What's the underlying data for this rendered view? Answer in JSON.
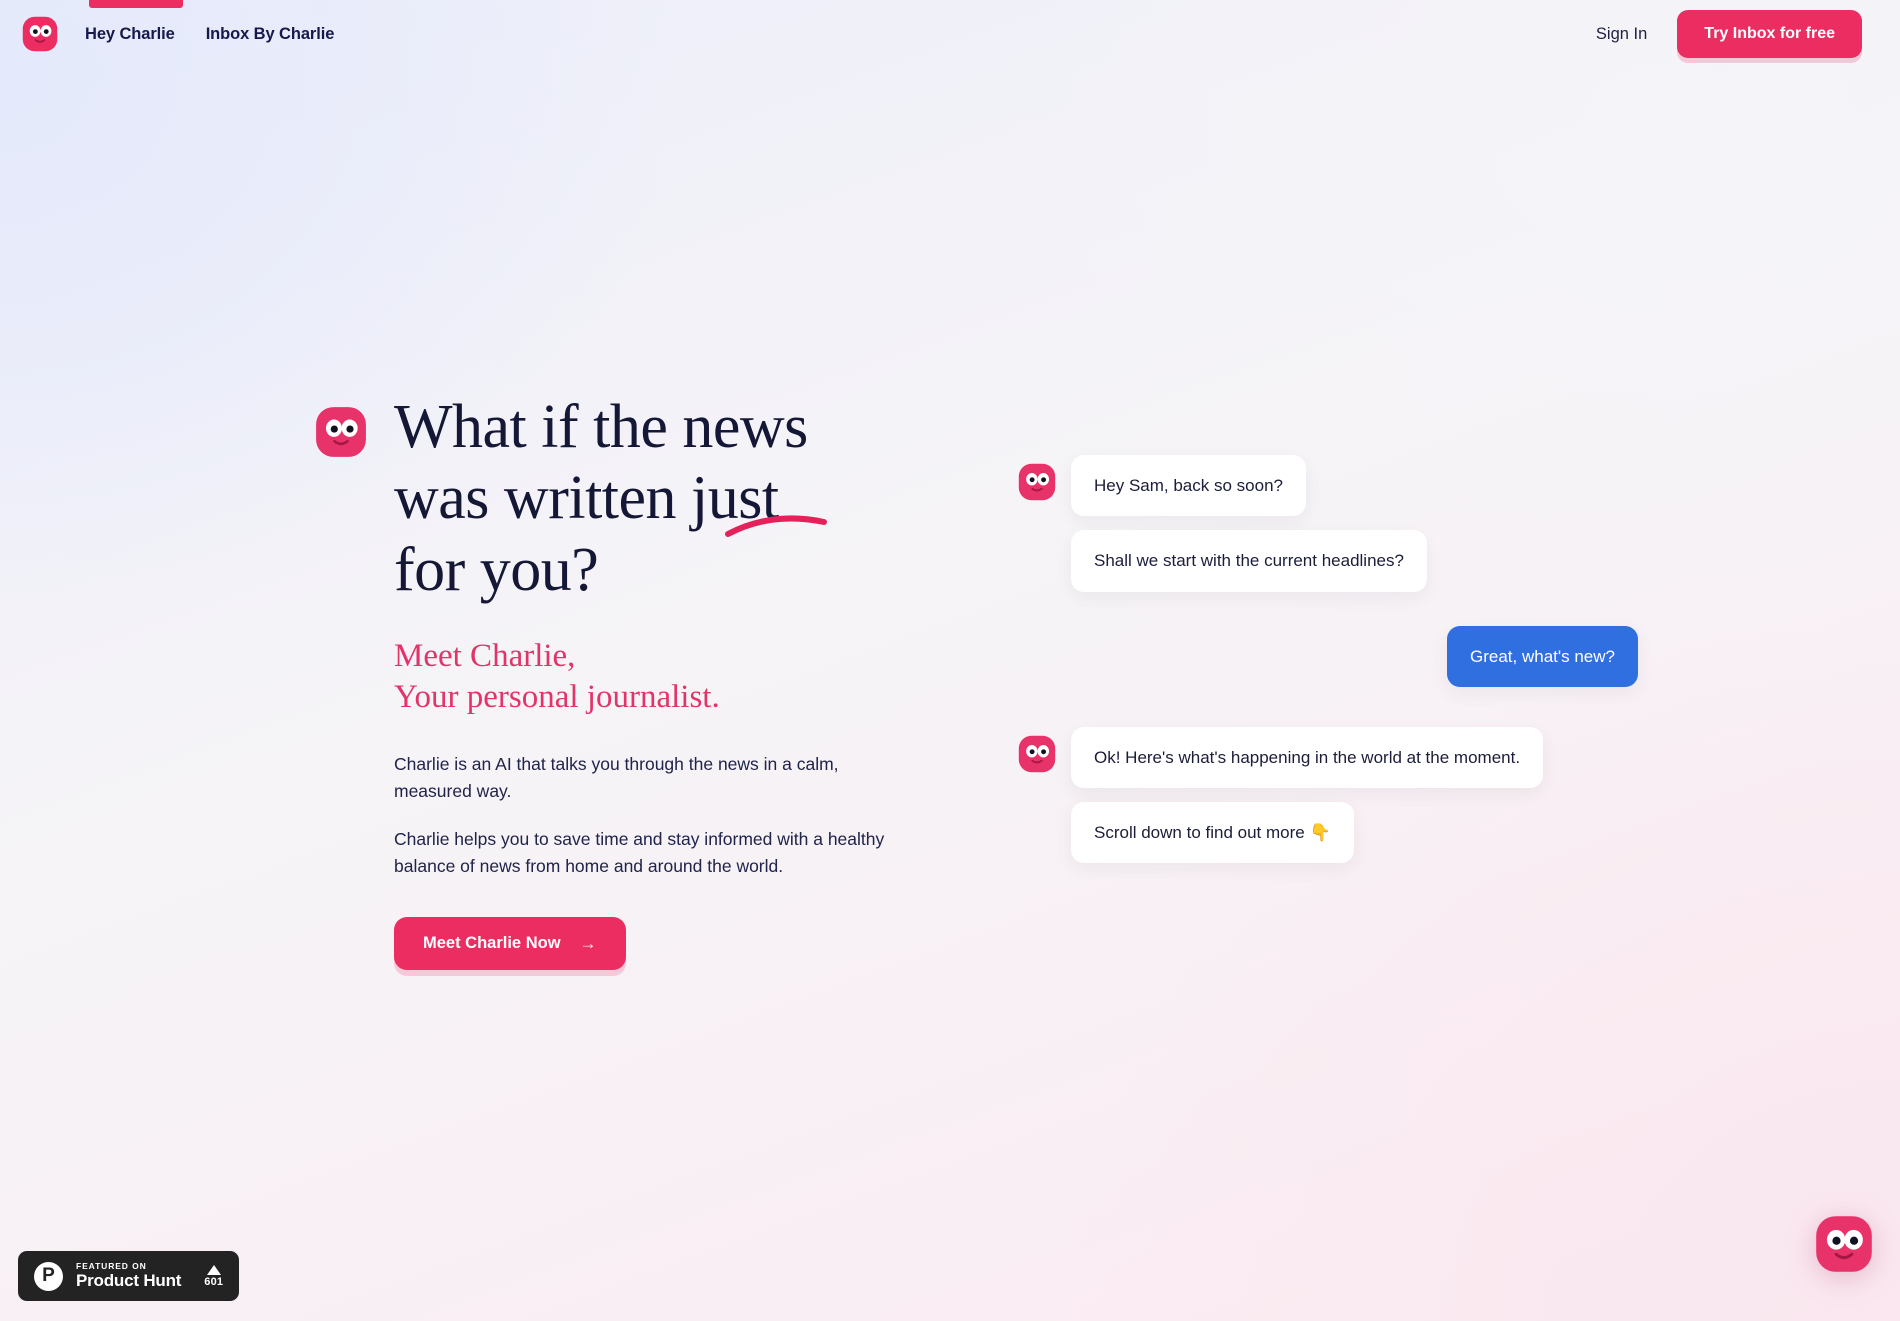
{
  "brand": {
    "logo_icon": "charlie-face-icon",
    "accent_pink": "#ec2d62",
    "accent_blue": "#2f6fe0",
    "ink": "#141735"
  },
  "header": {
    "nav": [
      {
        "label": "Hey Charlie",
        "active": true
      },
      {
        "label": "Inbox By Charlie",
        "active": false
      }
    ],
    "signin_label": "Sign In",
    "cta_label": "Try Inbox for free"
  },
  "hero": {
    "title_line1": "What if the news",
    "title_line2": "was written just",
    "title_line3": "for you?",
    "subtitle_line1": "Meet Charlie,",
    "subtitle_line2": "Your personal journalist.",
    "paragraph1": "Charlie is an AI that talks you through the news in a calm, measured way.",
    "paragraph2": "Charlie helps you to save time and stay informed with a healthy balance of news from home and around the world.",
    "cta_label": "Meet Charlie Now",
    "cta_arrow": "→"
  },
  "chat": {
    "messages": [
      {
        "from": "charlie",
        "text": "Hey Sam, back so soon?",
        "show_avatar": true
      },
      {
        "from": "charlie",
        "text": "Shall we start with the current headlines?",
        "show_avatar": false
      },
      {
        "from": "user",
        "text": "Great, what's new?",
        "show_avatar": false
      },
      {
        "from": "charlie",
        "text": "Ok! Here's what's happening in the world at the moment.",
        "show_avatar": true
      },
      {
        "from": "charlie",
        "text": "Scroll down to find out more 👇",
        "show_avatar": false
      }
    ]
  },
  "product_hunt": {
    "featured_label": "FEATURED ON",
    "name": "Product Hunt",
    "logo_letter": "P",
    "vote_count": "601"
  },
  "chat_widget": {
    "icon": "charlie-face-icon"
  }
}
